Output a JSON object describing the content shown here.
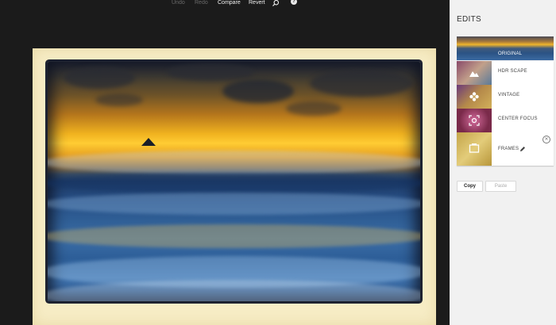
{
  "toolbar": {
    "undo_label": "Undo",
    "redo_label": "Redo",
    "compare_label": "Compare",
    "revert_label": "Revert",
    "search_icon": "search-icon",
    "help_icon": "help-icon",
    "help_glyph": "?"
  },
  "sidebar": {
    "title": "EDITS",
    "items": [
      {
        "label": "ORIGINAL",
        "icon": ""
      },
      {
        "label": "HDR SCAPE",
        "icon": "mountain-icon"
      },
      {
        "label": "VINTAGE",
        "icon": "flower-icon"
      },
      {
        "label": "CENTER FOCUS",
        "icon": "camera-focus-icon"
      },
      {
        "label": "FRAMES",
        "icon": "frame-icon",
        "edit_icon": "pencil-icon",
        "remove_icon": "close-circle-icon",
        "remove_glyph": "✕"
      }
    ],
    "copy_label": "Copy",
    "paste_label": "Paste"
  },
  "colors": {
    "canvas_background": "#1b1b1b",
    "sidebar_background": "#f1f1f1",
    "frame_color": "#f7edc6"
  }
}
